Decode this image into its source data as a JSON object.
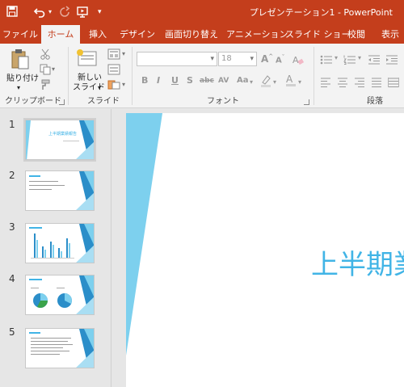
{
  "app": {
    "document_title": "プレゼンテーション1 - PowerPoint",
    "accent_color": "#c43e1c",
    "theme_color": "#41b4e6"
  },
  "quick_access": [
    {
      "icon": "save-icon"
    },
    {
      "icon": "undo-icon"
    },
    {
      "icon": "redo-icon"
    },
    {
      "icon": "start-from-beginning-icon"
    },
    {
      "icon": "customize-qat-icon"
    }
  ],
  "tabs": [
    "ファイル",
    "ホーム",
    "挿入",
    "デザイン",
    "画面切り替え",
    "アニメーション",
    "スライド ショー",
    "校閲",
    "表示"
  ],
  "active_tab": "ホーム",
  "ribbon": {
    "clipboard": {
      "paste_label": "貼り付け",
      "group_label": "クリップボード"
    },
    "slides": {
      "new_slide_label_1": "新しい",
      "new_slide_label_2": "スライド",
      "group_label": "スライド"
    },
    "font": {
      "font_name_value": "",
      "font_size_value": "18",
      "group_label": "フォント"
    },
    "paragraph": {
      "group_label": "段落"
    }
  },
  "slides": [
    {
      "number": "1",
      "title": "上半期業績報告"
    },
    {
      "number": "2",
      "title": ""
    },
    {
      "number": "3",
      "title": ""
    },
    {
      "number": "4",
      "title": ""
    },
    {
      "number": "5",
      "title": ""
    }
  ],
  "editor": {
    "slide_title": "上半期業"
  }
}
